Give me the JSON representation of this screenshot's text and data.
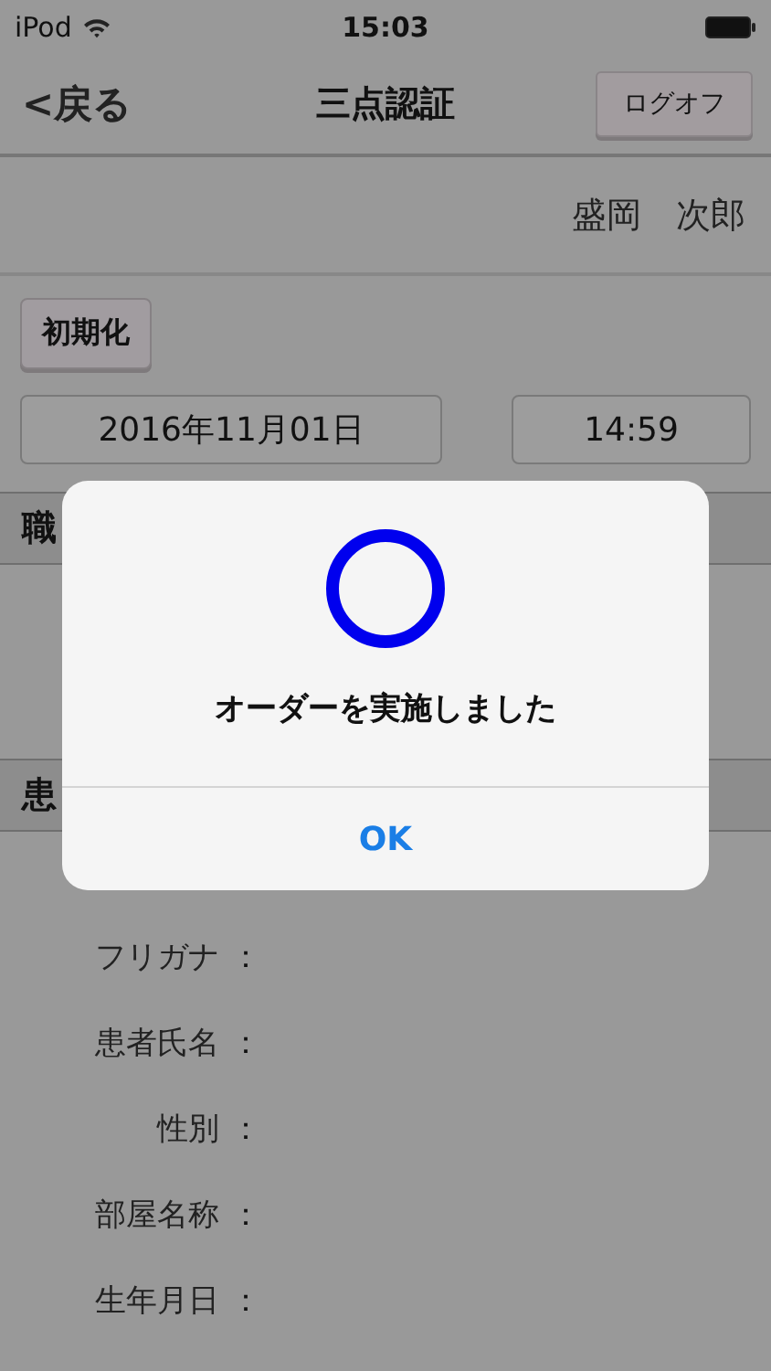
{
  "status_bar": {
    "carrier": "iPod",
    "time": "15:03"
  },
  "nav": {
    "back": "<戻る",
    "title": "三点認証",
    "logoff": "ログオフ"
  },
  "user_name": "盛岡　次郎",
  "reset_button": "初期化",
  "date": "2016年11月01日",
  "time": "14:59",
  "sections": [
    {
      "title": "職"
    },
    {
      "title": "患"
    }
  ],
  "fields": [
    {
      "label": "フリガナ",
      "colon": "："
    },
    {
      "label": "患者氏名",
      "colon": "："
    },
    {
      "label": "性別",
      "colon": "："
    },
    {
      "label": "部屋名称",
      "colon": "："
    },
    {
      "label": "生年月日",
      "colon": "："
    }
  ],
  "alert": {
    "message": "オーダーを実施しました",
    "button": "OK"
  }
}
